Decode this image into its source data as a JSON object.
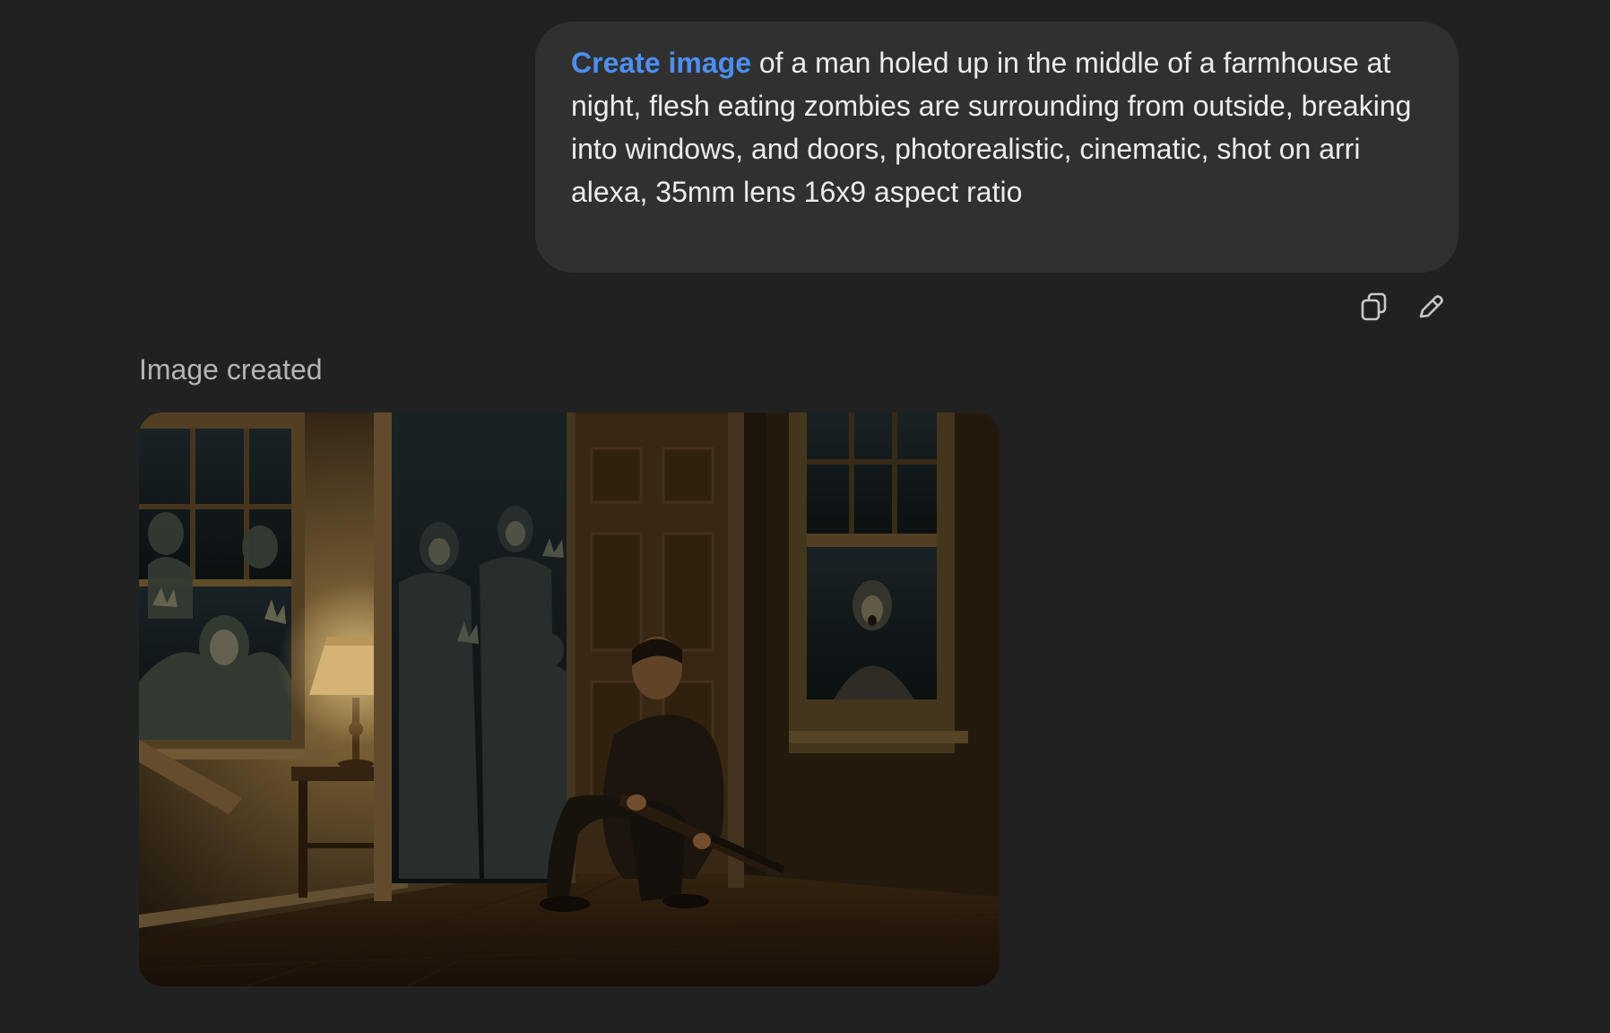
{
  "user_message": {
    "command": "Create image",
    "prompt": " of a man holed up in the middle of a farmhouse at night, flesh eating zombies are surrounding from outside, breaking into windows, and doors, photorealistic, cinematic, shot on arri alexa, 35mm lens 16x9 aspect ratio"
  },
  "message_actions": {
    "copy_icon": "copy-icon",
    "edit_icon": "pencil-icon"
  },
  "response": {
    "status": "Image created"
  },
  "colors": {
    "background": "#212121",
    "bubble": "#303030",
    "command_link": "#4d8ff0",
    "text": "#ececec",
    "muted": "#b4b4b4"
  }
}
